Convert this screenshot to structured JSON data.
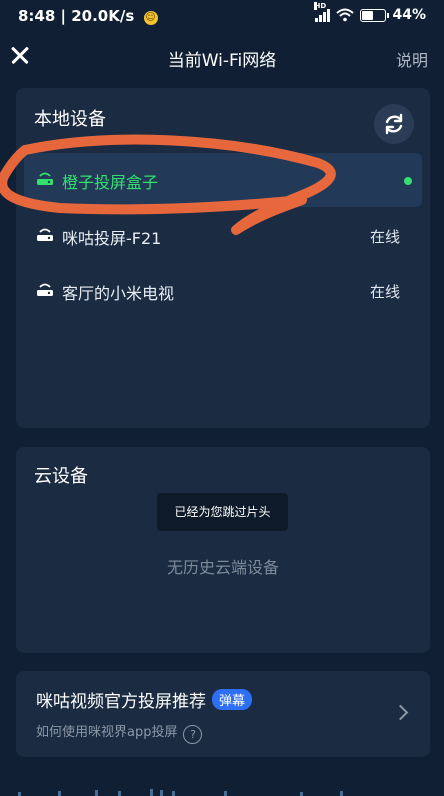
{
  "status_bar": {
    "time_speed": "8:48 | 20.0K/s",
    "signal_tag": "HD",
    "battery": "44%",
    "battery_level": 0.44
  },
  "header": {
    "title": "当前Wi-Fi网络",
    "help_label": "说明"
  },
  "local_devices": {
    "title": "本地设备",
    "devices": [
      {
        "name": "橙子投屏盒子",
        "status": "",
        "active": true
      },
      {
        "name": "咪咕投屏-F21",
        "status": "在线",
        "active": false
      },
      {
        "name": "客厅的小米电视",
        "status": "在线",
        "active": false
      }
    ]
  },
  "cloud_devices": {
    "title": "云设备",
    "toast": "已经为您跳过片头",
    "empty_text": "无历史云端设备"
  },
  "promo": {
    "title": "咪咕视频官方投屏推荐",
    "badge": "弹幕",
    "subtitle": "如何使用咪视界app投屏"
  },
  "colors": {
    "background": "#101f33",
    "card": "#1a2b42",
    "active_green": "#33e06e",
    "badge_blue": "#2d6ff5",
    "annotation_orange": "#f26a3c"
  },
  "icons": [
    "close-icon",
    "refresh-icon",
    "router-icon",
    "online-dot-icon",
    "help-circle-icon",
    "chevron-right-icon"
  ]
}
